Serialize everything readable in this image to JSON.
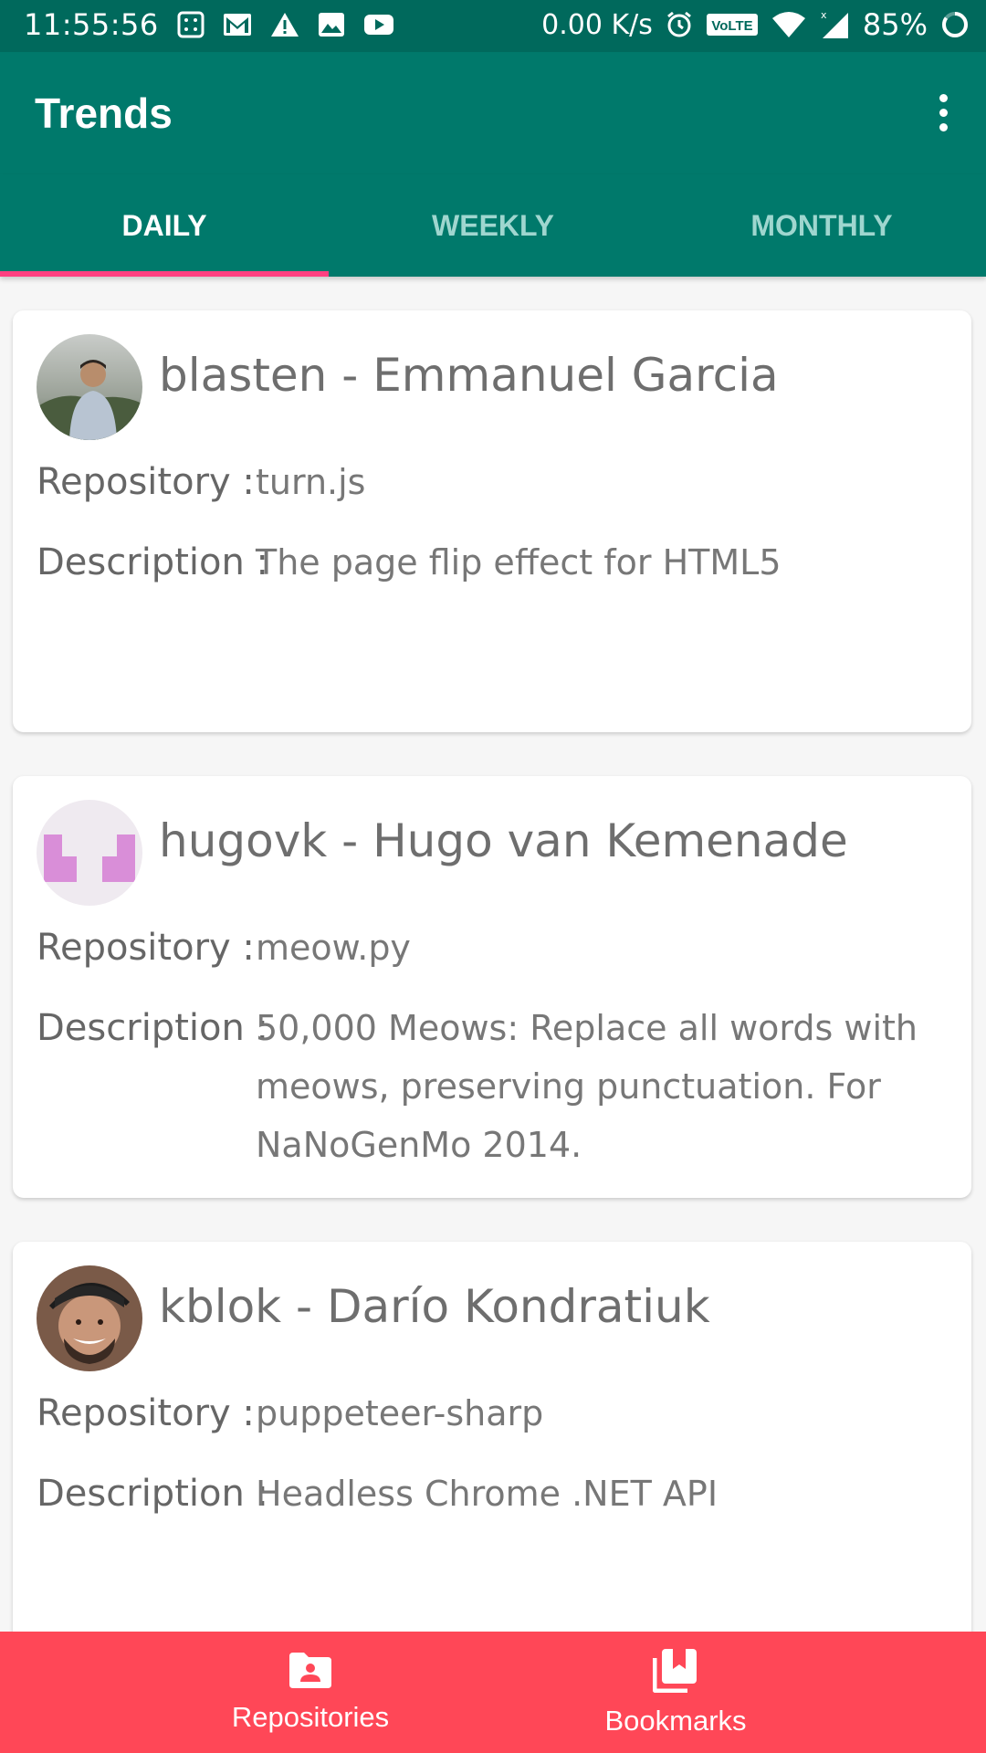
{
  "status_bar": {
    "time": "11:55:56",
    "net_speed": "0.00 K/s",
    "battery": "85%"
  },
  "app_bar": {
    "title": "Trends",
    "menu_icon": "more-vert-icon"
  },
  "tabs": [
    {
      "label": "DAILY",
      "active": true
    },
    {
      "label": "WEEKLY",
      "active": false
    },
    {
      "label": "MONTHLY",
      "active": false
    }
  ],
  "labels": {
    "repository": "Repository :",
    "description": "Description :"
  },
  "cards": [
    {
      "title": "blasten - Emmanuel Garcia",
      "repository": "turn.js",
      "description": "The page flip effect for HTML5"
    },
    {
      "title": "hugovk - Hugo van Kemenade",
      "repository": "meow.py",
      "description": "50,000 Meows: Replace all words with meows, preserving punctuation. For NaNoGenMo 2014."
    },
    {
      "title": "kblok - Darío Kondratiuk",
      "repository": "puppeteer-sharp",
      "description": "Headless Chrome .NET API"
    }
  ],
  "bottom_nav": [
    {
      "label": "Repositories",
      "icon": "folder-account-icon"
    },
    {
      "label": "Bookmarks",
      "icon": "bookmarks-stack-icon"
    }
  ],
  "colors": {
    "status_bar": "#00695c",
    "primary": "#00796b",
    "tab_indicator": "#ff4081",
    "bottom_nav": "#ff4757"
  }
}
